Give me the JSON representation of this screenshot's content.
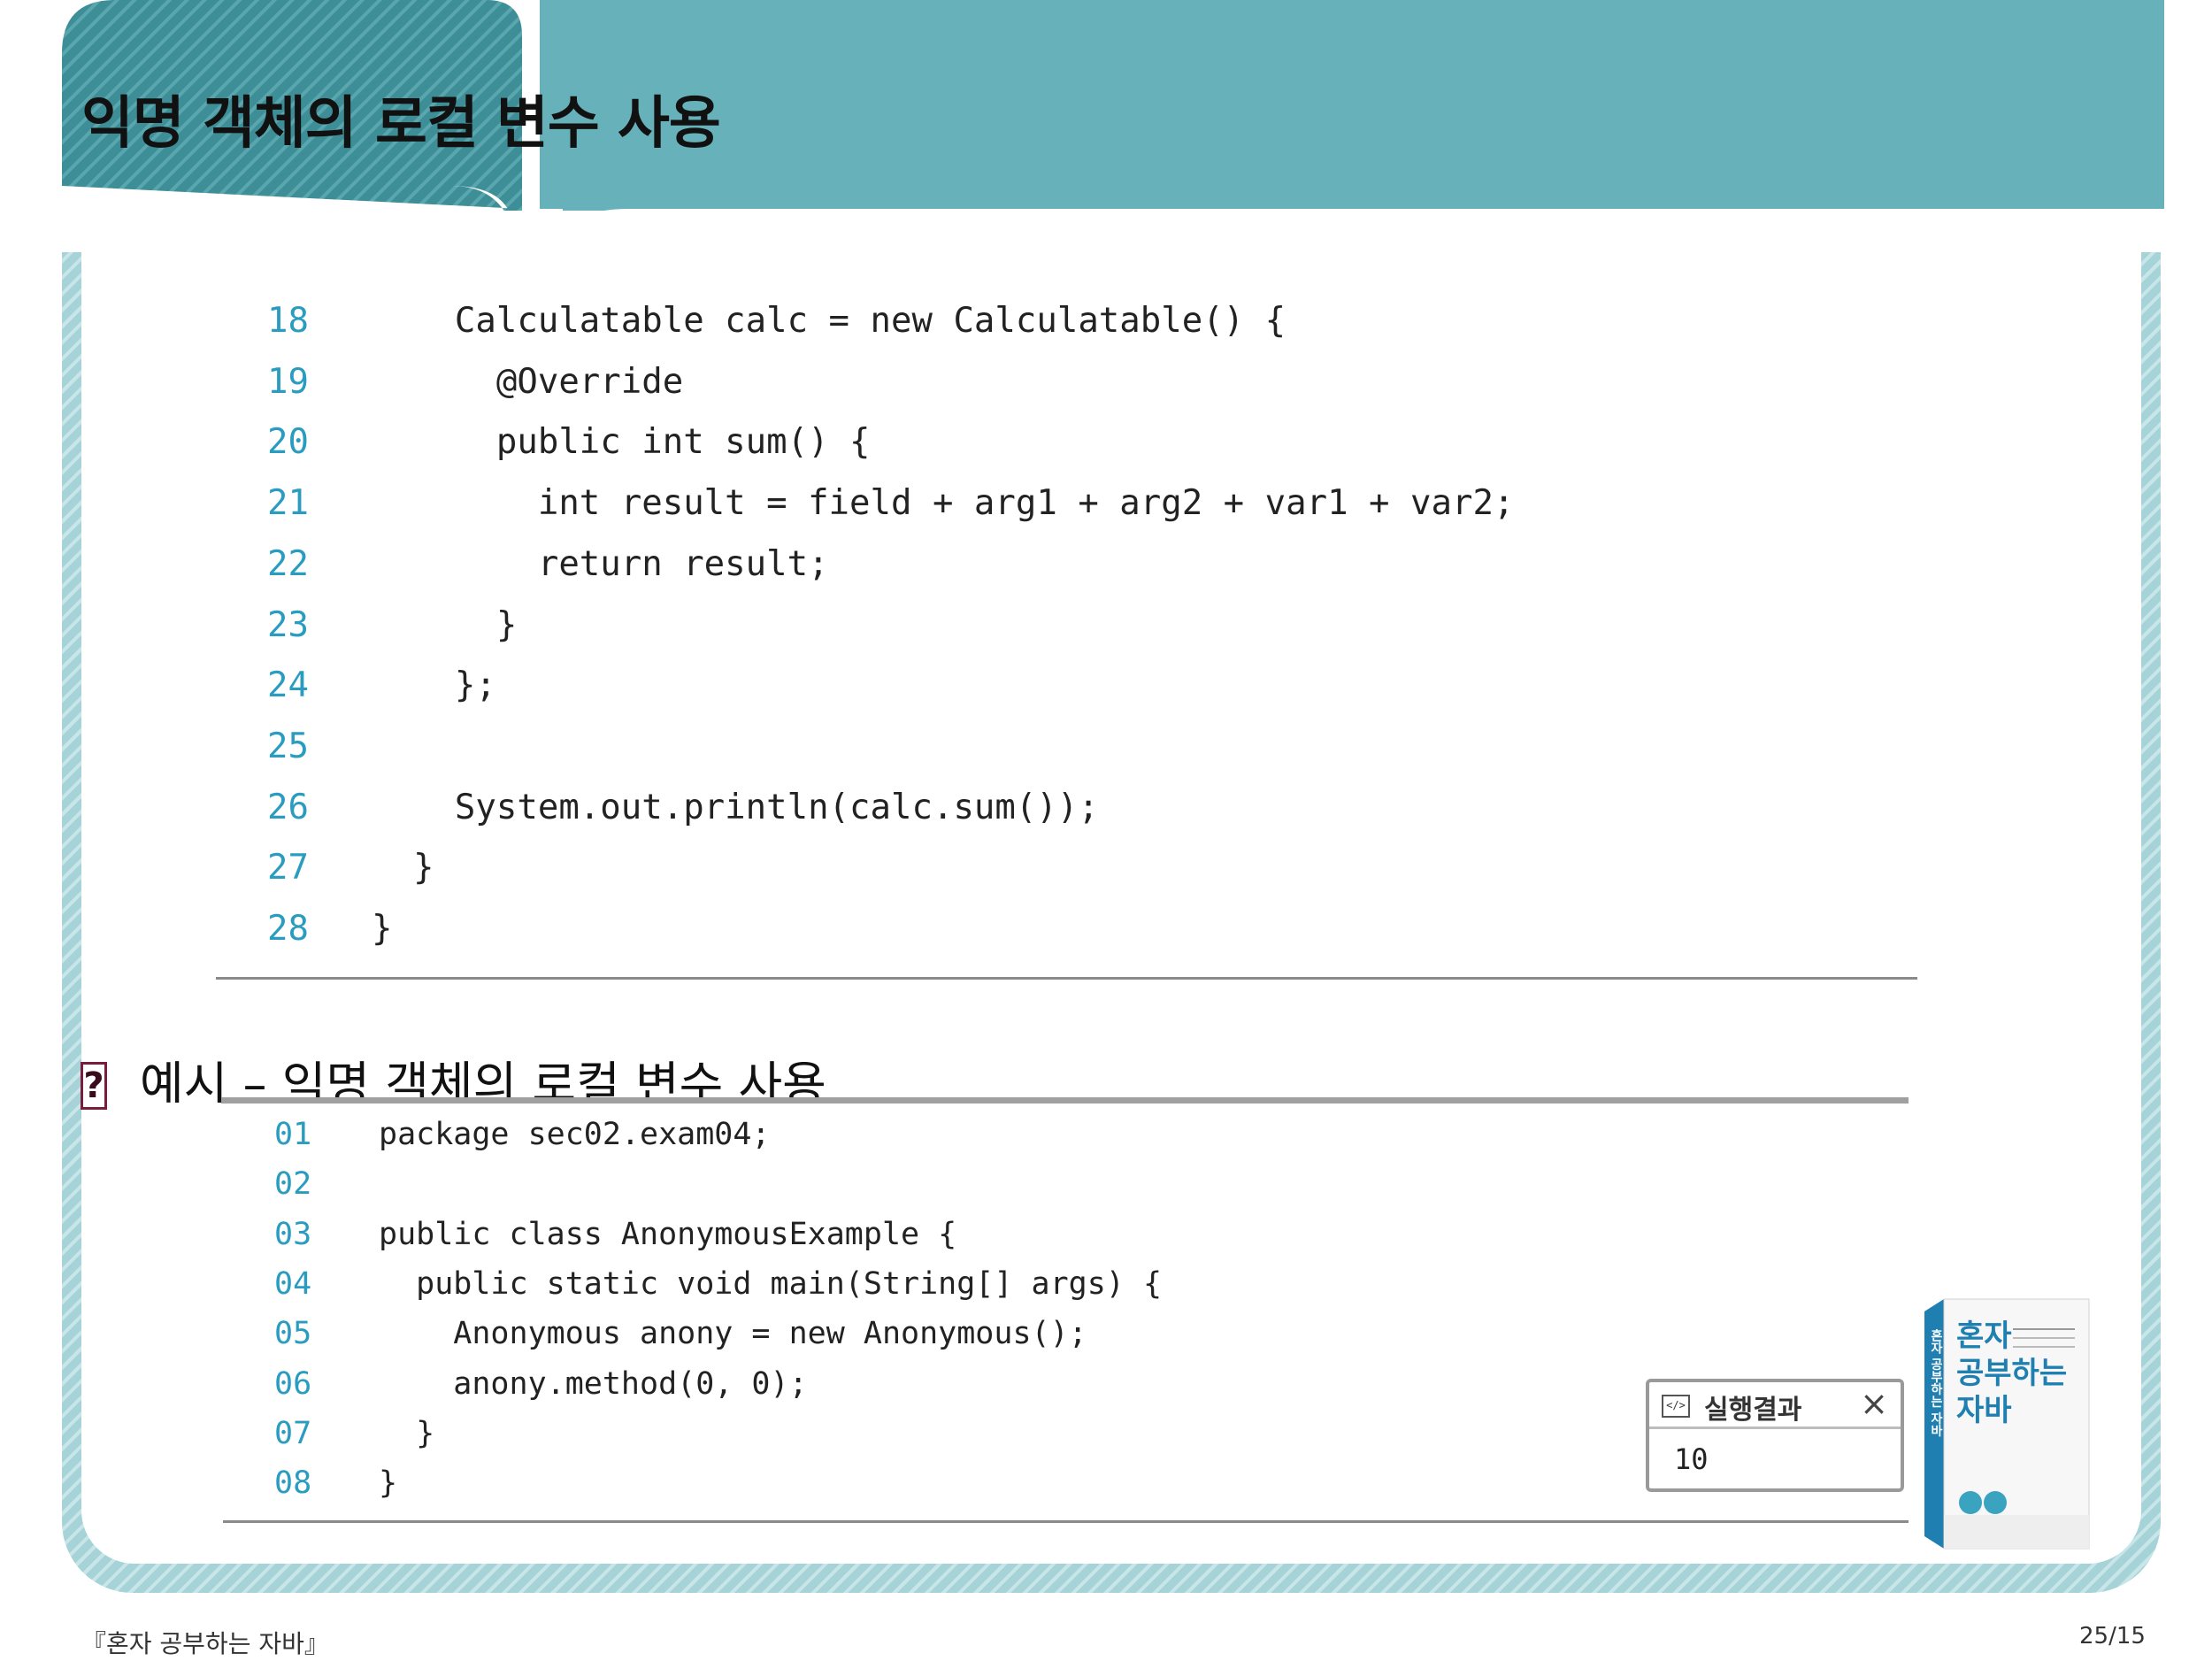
{
  "header": {
    "title": "익명 객체의 로컬 변수 사용"
  },
  "code_block_1": {
    "lines": [
      {
        "num": "18",
        "text": "    Calculatable calc = new Calculatable() {"
      },
      {
        "num": "19",
        "text": "      @Override"
      },
      {
        "num": "20",
        "text": "      public int sum() {"
      },
      {
        "num": "21",
        "text": "        int result = field + arg1 + arg2 + var1 + var2;"
      },
      {
        "num": "22",
        "text": "        return result;"
      },
      {
        "num": "23",
        "text": "      }"
      },
      {
        "num": "24",
        "text": "    };"
      },
      {
        "num": "25",
        "text": ""
      },
      {
        "num": "26",
        "text": "    System.out.println(calc.sum());"
      },
      {
        "num": "27",
        "text": "  }"
      },
      {
        "num": "28",
        "text": "}"
      }
    ]
  },
  "example": {
    "icon": "?",
    "heading": "예시 – 익명 객체의 로컬 변수 사용"
  },
  "code_block_2": {
    "lines": [
      {
        "num": "01",
        "text": "package sec02.exam04;"
      },
      {
        "num": "02",
        "text": ""
      },
      {
        "num": "03",
        "text": "public class AnonymousExample {"
      },
      {
        "num": "04",
        "text": "  public static void main(String[] args) {"
      },
      {
        "num": "05",
        "text": "    Anonymous anony = new Anonymous();"
      },
      {
        "num": "06",
        "text": "    anony.method(0, 0);"
      },
      {
        "num": "07",
        "text": "  }"
      },
      {
        "num": "08",
        "text": "}"
      }
    ]
  },
  "result_panel": {
    "title": "실행결과",
    "close_icon": "×",
    "output": "10"
  },
  "book_cover": {
    "title_chars": [
      "혼자",
      "공부하는",
      "자바"
    ],
    "spine_text": "혼자 공부하는 자바"
  },
  "footer": {
    "book": "『혼자 공부하는 자바』",
    "page": "25/15"
  },
  "colors": {
    "header_teal": "#66b1ba",
    "header_dark": "#2f7e87",
    "line_number": "#2a9cc0"
  }
}
